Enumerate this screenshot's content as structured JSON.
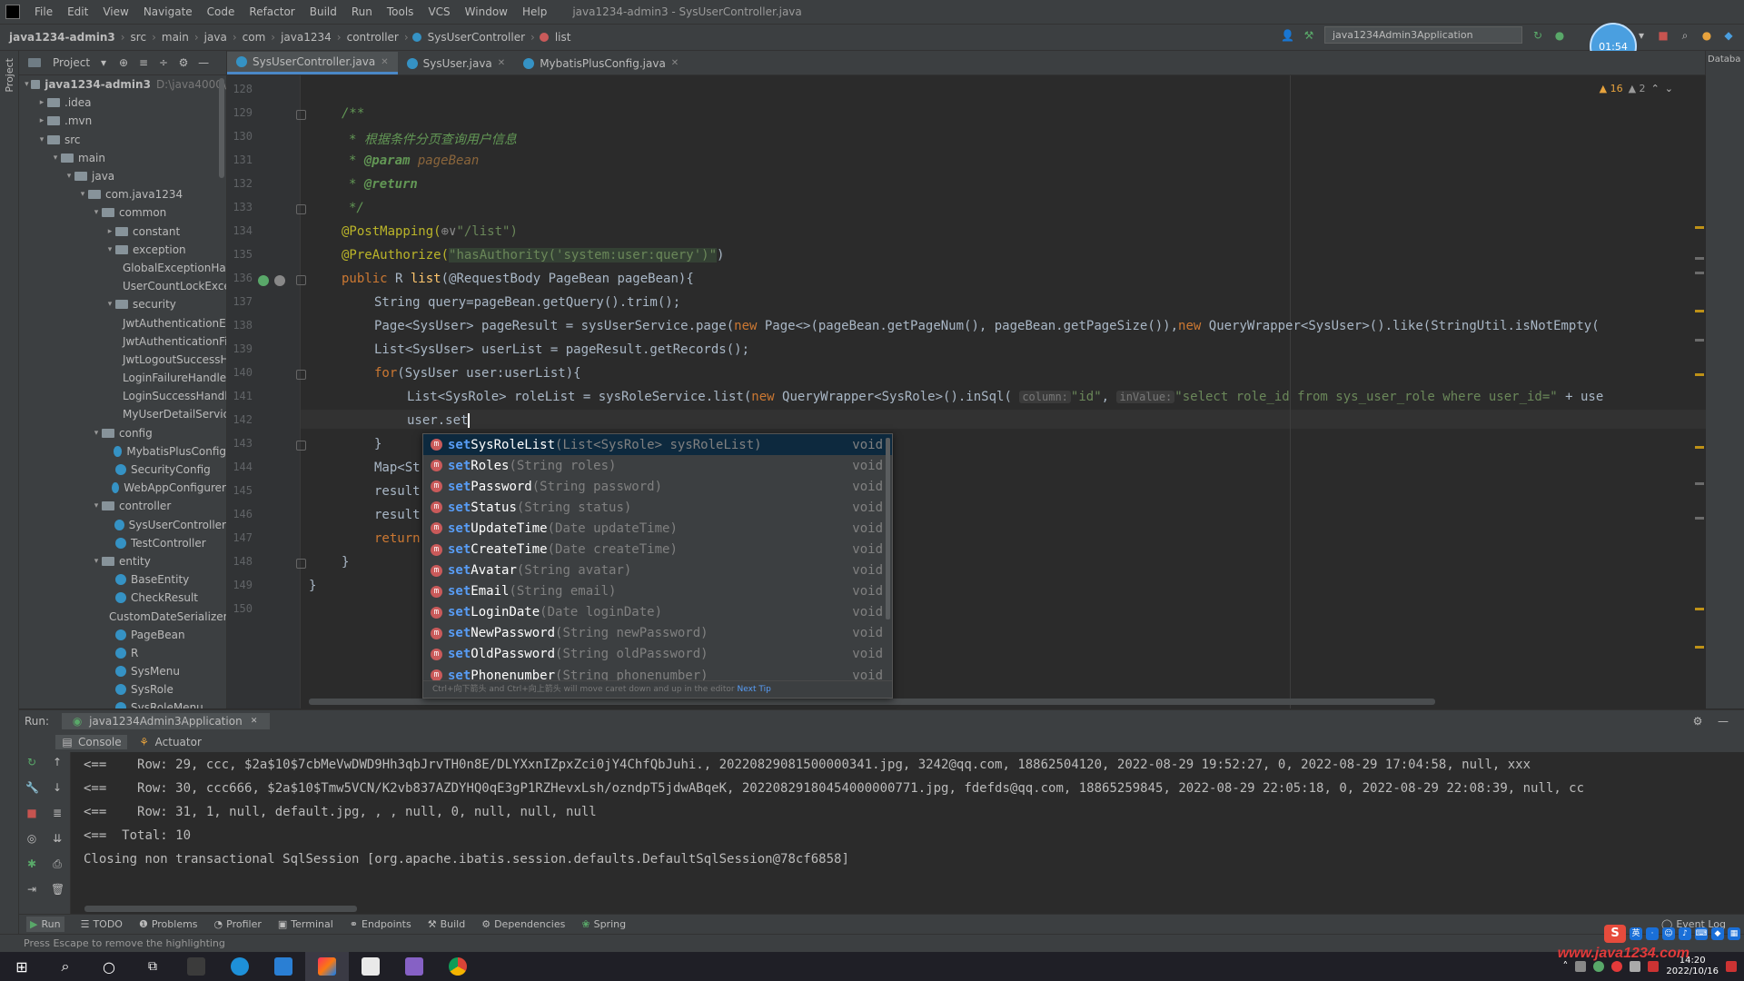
{
  "window": {
    "menu": [
      "File",
      "Edit",
      "View",
      "Navigate",
      "Code",
      "Refactor",
      "Build",
      "Run",
      "Tools",
      "VCS",
      "Window",
      "Help"
    ],
    "title": "java1234-admin3 - SysUserController.java"
  },
  "navbar": {
    "crumbs": [
      "java1234-admin3",
      "src",
      "main",
      "java",
      "com",
      "java1234",
      "controller",
      "SysUserController",
      "list"
    ],
    "run_config": "java1234Admin3Application",
    "avatar_text": "01:54"
  },
  "project": {
    "title": "Project",
    "tree": [
      {
        "label": "java1234-admin3",
        "dim": "D:\\java4000\\",
        "indent": 0,
        "arrow": "▾",
        "kind": "folder"
      },
      {
        "label": ".idea",
        "indent": 1,
        "arrow": "▸",
        "kind": "folder"
      },
      {
        "label": ".mvn",
        "indent": 1,
        "arrow": "▸",
        "kind": "folder"
      },
      {
        "label": "src",
        "indent": 1,
        "arrow": "▾",
        "kind": "folder"
      },
      {
        "label": "main",
        "indent": 2,
        "arrow": "▾",
        "kind": "folder"
      },
      {
        "label": "java",
        "indent": 3,
        "arrow": "▾",
        "kind": "folder"
      },
      {
        "label": "com.java1234",
        "indent": 4,
        "arrow": "▾",
        "kind": "folder"
      },
      {
        "label": "common",
        "indent": 5,
        "arrow": "▾",
        "kind": "folder"
      },
      {
        "label": "constant",
        "indent": 6,
        "arrow": "▸",
        "kind": "folder"
      },
      {
        "label": "exception",
        "indent": 6,
        "arrow": "▾",
        "kind": "folder"
      },
      {
        "label": "GlobalExceptionHandler",
        "indent": 7,
        "arrow": "",
        "kind": "class"
      },
      {
        "label": "UserCountLockException",
        "indent": 7,
        "arrow": "",
        "kind": "class"
      },
      {
        "label": "security",
        "indent": 6,
        "arrow": "▾",
        "kind": "folder"
      },
      {
        "label": "JwtAuthenticationEntryPoint",
        "indent": 7,
        "arrow": "",
        "kind": "class"
      },
      {
        "label": "JwtAuthenticationFilter",
        "indent": 7,
        "arrow": "",
        "kind": "class"
      },
      {
        "label": "JwtLogoutSuccessHandler",
        "indent": 7,
        "arrow": "",
        "kind": "class"
      },
      {
        "label": "LoginFailureHandler",
        "indent": 7,
        "arrow": "",
        "kind": "class"
      },
      {
        "label": "LoginSuccessHandler",
        "indent": 7,
        "arrow": "",
        "kind": "class"
      },
      {
        "label": "MyUserDetailServiceImpl",
        "indent": 7,
        "arrow": "",
        "kind": "class"
      },
      {
        "label": "config",
        "indent": 5,
        "arrow": "▾",
        "kind": "folder"
      },
      {
        "label": "MybatisPlusConfig",
        "indent": 6,
        "arrow": "",
        "kind": "class"
      },
      {
        "label": "SecurityConfig",
        "indent": 6,
        "arrow": "",
        "kind": "class"
      },
      {
        "label": "WebAppConfigurer",
        "indent": 6,
        "arrow": "",
        "kind": "class"
      },
      {
        "label": "controller",
        "indent": 5,
        "arrow": "▾",
        "kind": "folder"
      },
      {
        "label": "SysUserController",
        "indent": 6,
        "arrow": "",
        "kind": "class"
      },
      {
        "label": "TestController",
        "indent": 6,
        "arrow": "",
        "kind": "class"
      },
      {
        "label": "entity",
        "indent": 5,
        "arrow": "▾",
        "kind": "folder"
      },
      {
        "label": "BaseEntity",
        "indent": 6,
        "arrow": "",
        "kind": "class"
      },
      {
        "label": "CheckResult",
        "indent": 6,
        "arrow": "",
        "kind": "class"
      },
      {
        "label": "CustomDateSerializer",
        "indent": 6,
        "arrow": "",
        "kind": "class"
      },
      {
        "label": "PageBean",
        "indent": 6,
        "arrow": "",
        "kind": "class"
      },
      {
        "label": "R",
        "indent": 6,
        "arrow": "",
        "kind": "class"
      },
      {
        "label": "SysMenu",
        "indent": 6,
        "arrow": "",
        "kind": "class"
      },
      {
        "label": "SysRole",
        "indent": 6,
        "arrow": "",
        "kind": "class"
      },
      {
        "label": "SysRoleMenu",
        "indent": 6,
        "arrow": "",
        "kind": "class"
      }
    ]
  },
  "tabs": [
    {
      "label": "SysUserController.java",
      "active": true
    },
    {
      "label": "SysUser.java",
      "active": false
    },
    {
      "label": "MybatisPlusConfig.java",
      "active": false
    }
  ],
  "right_label": "Databa",
  "inspections": {
    "warnings": "▲ 16",
    "weak": "▲ 2"
  },
  "editor": {
    "line_numbers": [
      "128",
      "129",
      "130",
      "131",
      "132",
      "133",
      "134",
      "135",
      "136",
      "137",
      "138",
      "139",
      "140",
      "141",
      "142",
      "143",
      "144",
      "145",
      "146",
      "147",
      "148",
      "149",
      "150"
    ],
    "lines": {
      "l129": "/**",
      "l130": "* 根据条件分页查询用户信息",
      "l131_tag": "@param",
      "l131_param": "pageBean",
      "l132_tag": "@return",
      "l133": "*/",
      "l134_ann": "@PostMapping(",
      "l134_rest": "\"/list\")",
      "l135_ann": "@PreAuthorize(",
      "l135_str": "\"hasAuthority('system:user:query')\"",
      "l135_end": ")",
      "l136_kw": "public",
      "l136_a": " R ",
      "l136_fn": "list",
      "l136_b": "(@RequestBody PageBean pageBean){",
      "l137": "String query=pageBean.getQuery().trim();",
      "l138_a": "Page<SysUser> pageResult = sysUserService.page(",
      "l138_kw": "new",
      "l138_b": " Page<>(pageBean.getPageNum(), pageBean.getPageSize()),",
      "l138_kw2": "new",
      "l138_c": " QueryWrapper<SysUser>().like(StringUtil.isNotEmpty(",
      "l139": "List<SysUser> userList = pageResult.getRecords();",
      "l140_kw": "for",
      "l140_rest": "(SysUser user:userList){",
      "l141_a": "List<SysRole> roleList = sysRoleService.list(",
      "l141_kw": "new",
      "l141_b": " QueryWrapper<SysRole>().inSql(",
      "l141_hint1": "column:",
      "l141_str1": "\"id\"",
      "l141_hint2": "inValue:",
      "l141_str2": "\"select role_id from sys_user_role where user_id=\"",
      "l141_c": " + use",
      "l142": "user.set",
      "l143": "}",
      "l144": "Map<St",
      "l145": "result",
      "l146": "result",
      "l147_kw": "return",
      "l148": "}",
      "l149": "}"
    }
  },
  "completion": {
    "items": [
      {
        "prefix": "set",
        "name": "SysRoleList",
        "sig": "(List<SysRole> sysRoleList)",
        "ret": "void",
        "selected": true
      },
      {
        "prefix": "set",
        "name": "Roles",
        "sig": "(String roles)",
        "ret": "void"
      },
      {
        "prefix": "set",
        "name": "Password",
        "sig": "(String password)",
        "ret": "void"
      },
      {
        "prefix": "set",
        "name": "Status",
        "sig": "(String status)",
        "ret": "void"
      },
      {
        "prefix": "set",
        "name": "UpdateTime",
        "sig": "(Date updateTime)",
        "ret": "void"
      },
      {
        "prefix": "set",
        "name": "CreateTime",
        "sig": "(Date createTime)",
        "ret": "void"
      },
      {
        "prefix": "set",
        "name": "Avatar",
        "sig": "(String avatar)",
        "ret": "void"
      },
      {
        "prefix": "set",
        "name": "Email",
        "sig": "(String email)",
        "ret": "void"
      },
      {
        "prefix": "set",
        "name": "LoginDate",
        "sig": "(Date loginDate)",
        "ret": "void"
      },
      {
        "prefix": "set",
        "name": "NewPassword",
        "sig": "(String newPassword)",
        "ret": "void"
      },
      {
        "prefix": "set",
        "name": "OldPassword",
        "sig": "(String oldPassword)",
        "ret": "void"
      },
      {
        "prefix": "set",
        "name": "Phonenumber",
        "sig": "(String phonenumber)",
        "ret": "void"
      }
    ],
    "footer": "Ctrl+向下箭头 and Ctrl+向上箭头 will move caret down and up in the editor",
    "footer_link": "Next Tip"
  },
  "run": {
    "label": "Run:",
    "tab": "java1234Admin3Application",
    "sub_console": "Console",
    "sub_actuator": "Actuator",
    "lines": [
      {
        "p": "<==",
        "t": "    Row: 29, ccc, $2a$10$7cbMeVwDWD9Hh3qbJrvTH0n8E/DLYXxnIZpxZci0jY4ChfQbJuhi., 20220829081500000341.jpg, 3242@qq.com, 18862504120, 2022-08-29 19:52:27, 0, 2022-08-29 17:04:58, null, xxx"
      },
      {
        "p": "<==",
        "t": "    Row: 30, ccc666, $2a$10$Tmw5VCN/K2vb837AZDYHQ0qE3gP1RZHevxLsh/ozndpT5jdwABqeK, 20220829180454000000771.jpg, fdefds@qq.com, 18865259845, 2022-08-29 22:05:18, 0, 2022-08-29 22:08:39, null, cc"
      },
      {
        "p": "<==",
        "t": "    Row: 31, 1, null, default.jpg, , , null, 0, null, null, null"
      },
      {
        "p": "<==",
        "t": "  Total: 10"
      },
      {
        "p": "",
        "t": "Closing non transactional SqlSession [org.apache.ibatis.session.defaults.DefaultSqlSession@78cf6858]"
      }
    ]
  },
  "bottom_tools": [
    "Run",
    "TODO",
    "Problems",
    "Profiler",
    "Terminal",
    "Endpoints",
    "Build",
    "Dependencies",
    "Spring"
  ],
  "event_log": "Event Log",
  "status": "Press Escape to remove the highlighting",
  "taskbar": {
    "clock_time": "14:20",
    "clock_date": "2022/10/16"
  },
  "watermark": "www.java1234.com"
}
